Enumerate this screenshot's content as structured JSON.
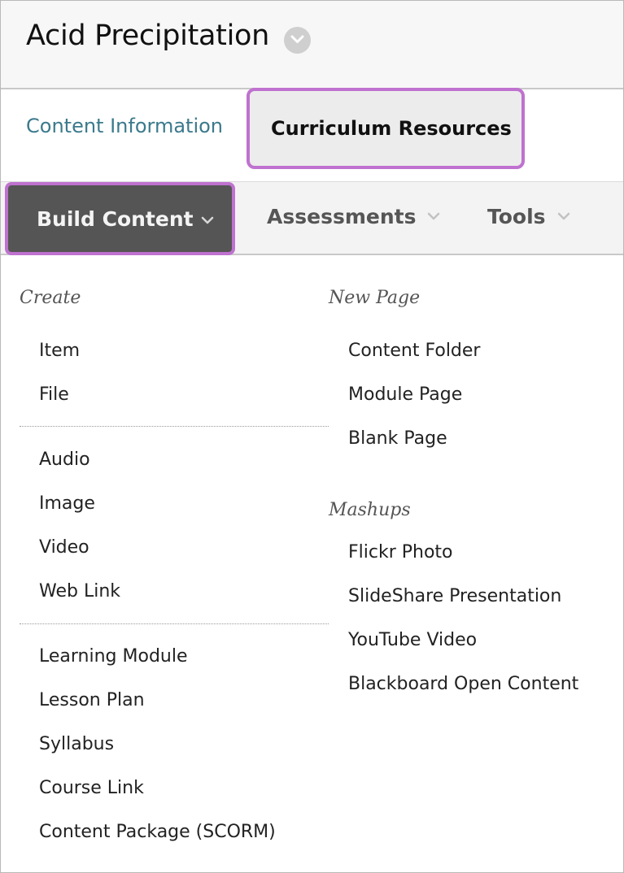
{
  "page": {
    "title": "Acid Precipitation",
    "title_menu_icon": "chevron-down-icon"
  },
  "tabs": [
    {
      "label": "Content Information",
      "active": false
    },
    {
      "label": "Curriculum Resources",
      "active": true
    }
  ],
  "action_bar": {
    "build_content": "Build Content",
    "assessments": "Assessments",
    "tools": "Tools"
  },
  "menu": {
    "create": {
      "heading": "Create",
      "group1": [
        "Item",
        "File"
      ],
      "group2": [
        "Audio",
        "Image",
        "Video",
        "Web Link"
      ],
      "group3": [
        "Learning Module",
        "Lesson Plan",
        "Syllabus",
        "Course Link",
        "Content Package (SCORM)"
      ]
    },
    "new_page": {
      "heading": "New Page",
      "items": [
        "Content Folder",
        "Module Page",
        "Blank Page"
      ]
    },
    "mashups": {
      "heading": "Mashups",
      "items": [
        "Flickr Photo",
        "SlideShare Presentation",
        "YouTube Video",
        "Blackboard Open Content"
      ]
    }
  },
  "colors": {
    "highlight": "#bf72cf",
    "tab_link": "#3b7a8c",
    "build_button": "#555555"
  }
}
